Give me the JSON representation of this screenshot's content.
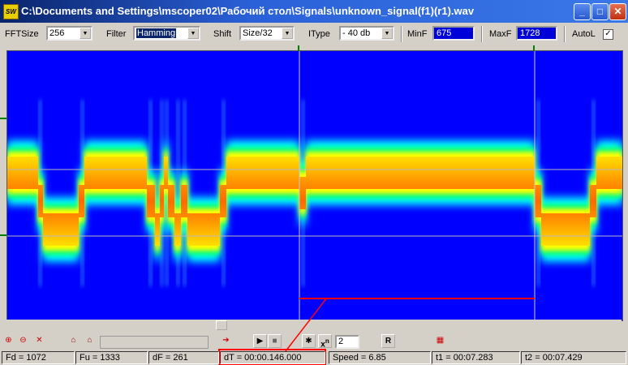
{
  "window": {
    "title": "C:\\Documents and Settings\\mscoper02\\Рабочий стол\\Signals\\unknown_signal(f1)(r1).wav",
    "app_icon_text": "SW"
  },
  "toolbar": {
    "fftsize_label": "FFTSize",
    "fftsize_value": "256",
    "filter_label": "Filter",
    "filter_value": "Hamming",
    "shift_label": "Shift",
    "shift_value": "Size/32",
    "itype_label": "IType",
    "itype_value": "- 40 db",
    "minf_label": "MinF",
    "minf_value": "675",
    "maxf_label": "MaxF",
    "maxf_value": "1728",
    "autol_label": "AutoL",
    "autol_checked": true
  },
  "controls": {
    "power_value": "2",
    "power_label": "x",
    "power_sup": "n",
    "r_label": "R"
  },
  "status": {
    "fd": "Fd = 1072",
    "fu": "Fu = 1333",
    "df": "dF = 261",
    "dt": "dT = 00:00.146.000",
    "speed": "Speed = 6.85",
    "t1": "t1 = 00:07.283",
    "t2": "t2 = 00:07.429"
  },
  "colors": {
    "background": "#0000ff",
    "signal_core": "#ff6a00",
    "signal_mid": "#ffff00",
    "signal_edge": "#00ffff",
    "annotation": "#ff0000",
    "accent": "#0a246a"
  }
}
